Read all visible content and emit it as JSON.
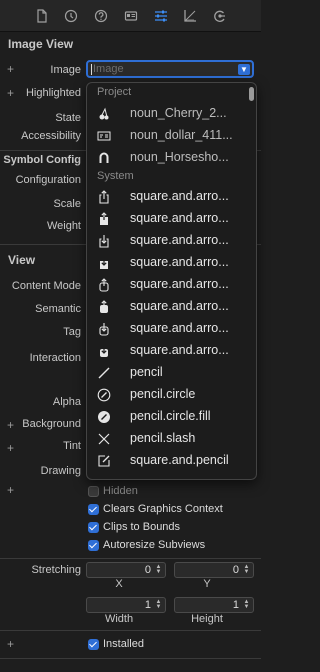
{
  "toolbar": {
    "icons": [
      "file-icon",
      "history-icon",
      "help-icon",
      "identity-icon",
      "attributes-icon",
      "size-icon",
      "connections-icon"
    ],
    "active": "attributes-icon"
  },
  "image_view": {
    "title": "Image View",
    "image_label": "Image",
    "image_placeholder": "Image",
    "highlighted_label": "Highlighted",
    "state_label": "State",
    "accessibility_label": "Accessibility",
    "symbol_config_label": "Symbol Config",
    "configuration_label": "Configuration",
    "scale_label": "Scale",
    "weight_label": "Weight"
  },
  "dropdown": {
    "groups": {
      "project": "Project",
      "system": "System"
    },
    "project_items": [
      "noun_Cherry_2...",
      "noun_dollar_411...",
      "noun_Horsesho..."
    ],
    "system_items": [
      {
        "icon": "square-and-arrow-up-icon",
        "label": "square.and.arro..."
      },
      {
        "icon": "square-and-arrow-up-fill-icon",
        "label": "square.and.arro..."
      },
      {
        "icon": "square-and-arrow-down-icon",
        "label": "square.and.arro..."
      },
      {
        "icon": "square-and-arrow-down-fill-icon",
        "label": "square.and.arro..."
      },
      {
        "icon": "square-and-arrow-up-on-square-icon",
        "label": "square.and.arro..."
      },
      {
        "icon": "square-and-arrow-up-on-square-fill-icon",
        "label": "square.and.arro..."
      },
      {
        "icon": "square-and-arrow-down-on-square-icon",
        "label": "square.and.arro..."
      },
      {
        "icon": "square-and-arrow-down-on-square-fill-icon",
        "label": "square.and.arro..."
      },
      {
        "icon": "pencil-icon",
        "label": "pencil"
      },
      {
        "icon": "pencil-circle-icon",
        "label": "pencil.circle"
      },
      {
        "icon": "pencil-circle-fill-icon",
        "label": "pencil.circle.fill"
      },
      {
        "icon": "pencil-slash-icon",
        "label": "pencil.slash"
      },
      {
        "icon": "square-and-pencil-icon",
        "label": "square.and.pencil"
      }
    ]
  },
  "view": {
    "title": "View",
    "content_mode_label": "Content Mode",
    "semantic_label": "Semantic",
    "tag_label": "Tag",
    "interaction_label": "Interaction",
    "alpha_label": "Alpha",
    "background_label": "Background",
    "tint_label": "Tint",
    "drawing_label": "Drawing",
    "checkboxes": {
      "hidden": {
        "label": "Hidden",
        "checked": false
      },
      "clears_graphics_context": {
        "label": "Clears Graphics Context",
        "checked": true
      },
      "clips_to_bounds": {
        "label": "Clips to Bounds",
        "checked": true
      },
      "autoresize_subviews": {
        "label": "Autoresize Subviews",
        "checked": true
      }
    },
    "stretching_label": "Stretching",
    "stretch_x": "0",
    "stretch_y": "0",
    "x_label": "X",
    "y_label": "Y",
    "stretch_width": "1",
    "stretch_height": "1",
    "width_label": "Width",
    "height_label": "Height",
    "installed": {
      "label": "Installed",
      "checked": true
    }
  },
  "colors": {
    "accent": "#2f6fd6",
    "panel": "#1e1e1e",
    "active_icon": "#3c8ef7"
  }
}
